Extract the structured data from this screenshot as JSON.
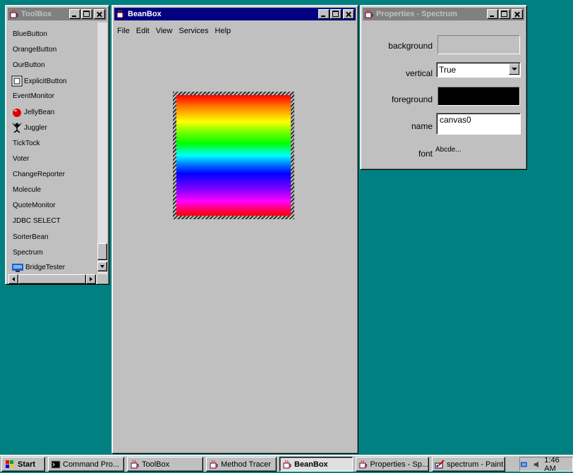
{
  "toolbox": {
    "title": "ToolBox",
    "items": [
      {
        "label": "BlueButton",
        "icon": "none"
      },
      {
        "label": "OrangeButton",
        "icon": "none"
      },
      {
        "label": "OurButton",
        "icon": "none"
      },
      {
        "label": "ExplicitButton",
        "icon": "explicit-button-icon"
      },
      {
        "label": "EventMonitor",
        "icon": "none"
      },
      {
        "label": "JellyBean",
        "icon": "jellybean-icon"
      },
      {
        "label": "Juggler",
        "icon": "juggler-icon"
      },
      {
        "label": "TickTock",
        "icon": "none"
      },
      {
        "label": "Voter",
        "icon": "none"
      },
      {
        "label": "ChangeReporter",
        "icon": "none"
      },
      {
        "label": "Molecule",
        "icon": "none"
      },
      {
        "label": "QuoteMonitor",
        "icon": "none"
      },
      {
        "label": "JDBC SELECT",
        "icon": "none"
      },
      {
        "label": "SorterBean",
        "icon": "none"
      },
      {
        "label": "Spectrum",
        "icon": "none"
      },
      {
        "label": "BridgeTester",
        "icon": "bridge-tester-icon"
      }
    ]
  },
  "beanbox": {
    "title": "BeanBox",
    "menu": [
      "File",
      "Edit",
      "View",
      "Services",
      "Help"
    ]
  },
  "properties": {
    "title": "Properties - Spectrum",
    "background_label": "background",
    "background_color": "#c0c0c0",
    "vertical_label": "vertical",
    "vertical_value": "True",
    "foreground_label": "foreground",
    "foreground_color": "#000000",
    "name_label": "name",
    "name_value": "canvas0",
    "font_label": "font",
    "font_value": "Abcde..."
  },
  "taskbar": {
    "start_label": "Start",
    "buttons": [
      {
        "label": "Command Pro...",
        "icon": "command-prompt-icon"
      },
      {
        "label": "ToolBox",
        "icon": "java-cup-icon"
      },
      {
        "label": "Method Tracer",
        "icon": "java-cup-icon"
      },
      {
        "label": "BeanBox",
        "icon": "java-cup-icon",
        "pressed": true
      },
      {
        "label": "Properties - Sp...",
        "icon": "java-cup-icon"
      },
      {
        "label": "spectrum - Paint",
        "icon": "paint-icon"
      }
    ],
    "clock": "1:46 AM"
  }
}
